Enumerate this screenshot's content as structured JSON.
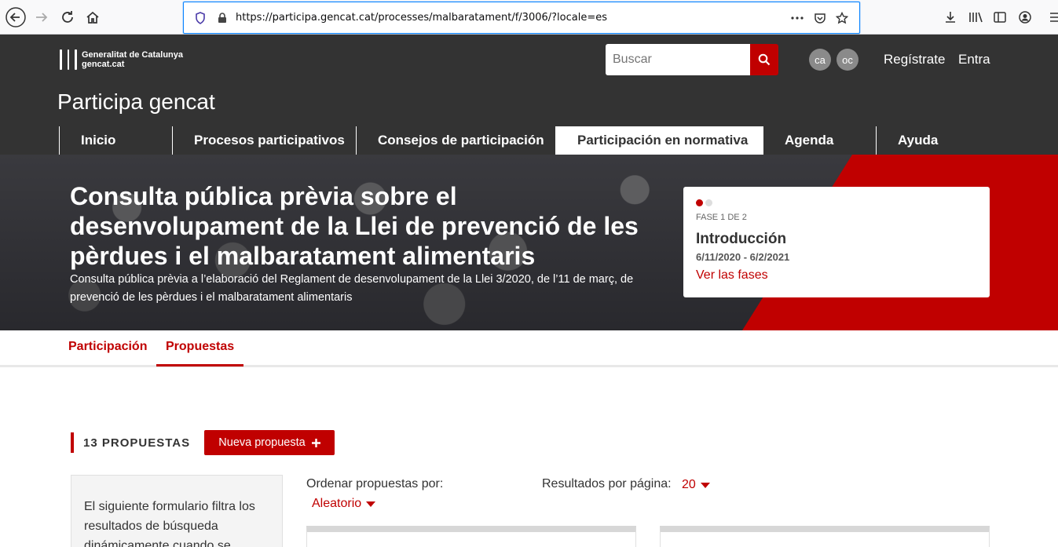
{
  "browser": {
    "url": "https://participa.gencat.cat/processes/malbaratament/f/3006/?locale=es"
  },
  "header": {
    "logo_line1": "Generalitat de Catalunya",
    "logo_line2": "gencat.cat",
    "search_placeholder": "Buscar",
    "lang_ca": "ca",
    "lang_oc": "oc",
    "register": "Regístrate",
    "login": "Entra",
    "site_title": "Participa gencat"
  },
  "nav": {
    "items": [
      "Inicio",
      "Procesos participativos",
      "Consejos de participación",
      "Participación en normativa",
      "Agenda",
      "Ayuda"
    ]
  },
  "hero": {
    "title": "Consulta pública prèvia sobre el desenvolupament de la Llei de prevenció de les pèrdues i el malbaratament alimentaris",
    "subtitle": "Consulta pública prèvia a l’elaboració del Reglament de desenvolupament de la Llei 3/2020, de l’11 de març, de prevenció de les pèrdues i el malbaratament alimentaris"
  },
  "phase": {
    "label": "FASE 1 DE 2",
    "name": "Introducción",
    "dates": "6/11/2020 - 6/2/2021",
    "link": "Ver las fases"
  },
  "tabs": {
    "participation": "Participación",
    "proposals": "Propuestas"
  },
  "proposals": {
    "count": "13 PROPUESTAS",
    "new_button": "Nueva propuesta",
    "filter_text": "El siguiente formulario filtra los resultados de búsqueda dinámicamente cuando se",
    "sort_label": "Ordenar propuestas por:",
    "sort_value": "Aleatorio",
    "per_page_label": "Resultados por página:",
    "per_page_value": "20"
  },
  "colors": {
    "accent": "#c00000",
    "header_bg": "#333333"
  }
}
